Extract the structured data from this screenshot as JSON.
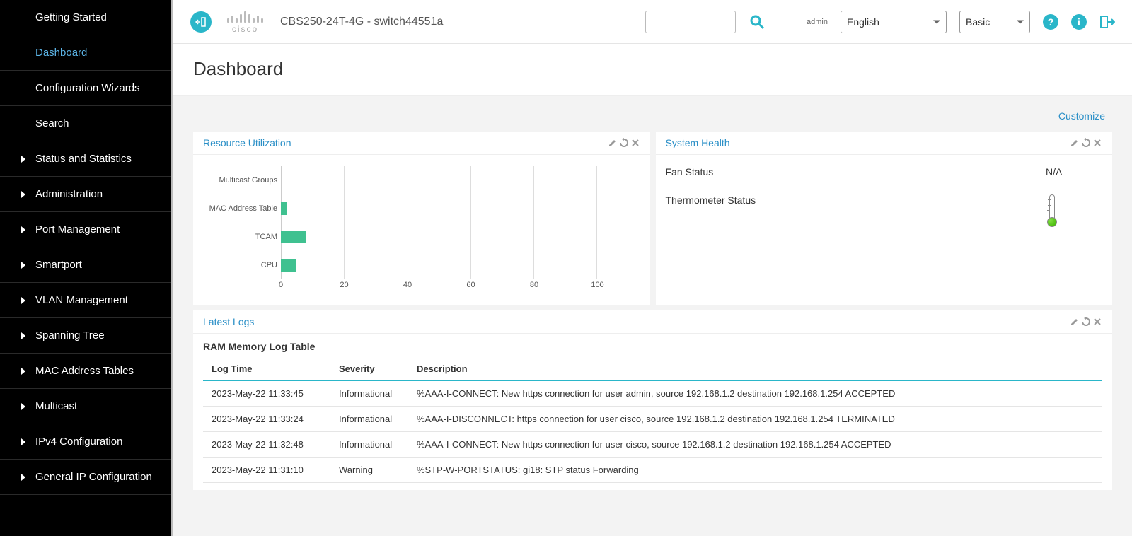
{
  "header": {
    "device_name": "CBS250-24T-4G - switch44551a",
    "admin_label": "admin",
    "language_selected": "English",
    "mode_selected": "Basic",
    "search_placeholder": ""
  },
  "sidebar": {
    "items": [
      {
        "label": "Getting Started",
        "children": false,
        "active": false
      },
      {
        "label": "Dashboard",
        "children": false,
        "active": true
      },
      {
        "label": "Configuration Wizards",
        "children": false,
        "active": false
      },
      {
        "label": "Search",
        "children": false,
        "active": false
      },
      {
        "label": "Status and Statistics",
        "children": true,
        "active": false
      },
      {
        "label": "Administration",
        "children": true,
        "active": false
      },
      {
        "label": "Port Management",
        "children": true,
        "active": false
      },
      {
        "label": "Smartport",
        "children": true,
        "active": false
      },
      {
        "label": "VLAN Management",
        "children": true,
        "active": false
      },
      {
        "label": "Spanning Tree",
        "children": true,
        "active": false
      },
      {
        "label": "MAC Address Tables",
        "children": true,
        "active": false
      },
      {
        "label": "Multicast",
        "children": true,
        "active": false
      },
      {
        "label": "IPv4 Configuration",
        "children": true,
        "active": false
      },
      {
        "label": "General IP Configuration",
        "children": true,
        "active": false
      }
    ]
  },
  "page": {
    "title": "Dashboard",
    "customize_label": "Customize"
  },
  "cards": {
    "resource": {
      "title": "Resource Utilization"
    },
    "health": {
      "title": "System Health",
      "fan_label": "Fan Status",
      "fan_value": "N/A",
      "thermo_label": "Thermometer Status"
    },
    "logs": {
      "title": "Latest Logs",
      "table_title": "RAM Memory Log Table",
      "columns": {
        "time": "Log Time",
        "severity": "Severity",
        "description": "Description"
      },
      "rows": [
        {
          "time": "2023-May-22 11:33:45",
          "severity": "Informational",
          "desc": "%AAA-I-CONNECT: New https connection for user admin, source 192.168.1.2 destination 192.168.1.254 ACCEPTED"
        },
        {
          "time": "2023-May-22 11:33:24",
          "severity": "Informational",
          "desc": "%AAA-I-DISCONNECT: https connection for user cisco, source 192.168.1.2 destination 192.168.1.254 TERMINATED"
        },
        {
          "time": "2023-May-22 11:32:48",
          "severity": "Informational",
          "desc": "%AAA-I-CONNECT: New https connection for user cisco, source 192.168.1.2 destination 192.168.1.254 ACCEPTED"
        },
        {
          "time": "2023-May-22 11:31:10",
          "severity": "Warning",
          "desc": "%STP-W-PORTSTATUS: gi18: STP status Forwarding"
        }
      ]
    }
  },
  "chart_data": {
    "type": "bar",
    "orientation": "horizontal",
    "categories": [
      "Multicast Groups",
      "MAC Address Table",
      "TCAM",
      "CPU"
    ],
    "values": [
      0,
      2,
      8,
      5
    ],
    "xlabel": "",
    "ylabel": "",
    "xlim": [
      0,
      100
    ],
    "xticks": [
      0,
      20,
      40,
      60,
      80,
      100
    ],
    "title": ""
  }
}
